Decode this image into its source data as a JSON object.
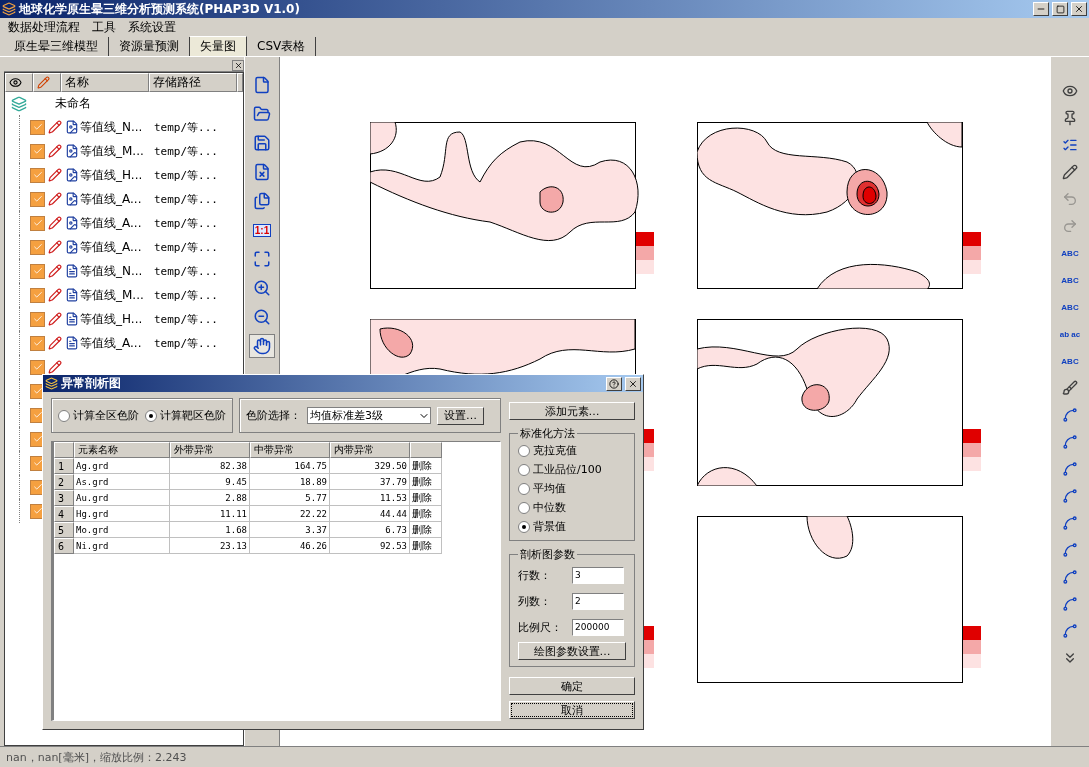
{
  "window": {
    "title": "地球化学原生晕三维分析预测系统(PHAP3D V1.0)"
  },
  "menu": [
    "数据处理流程",
    "工具",
    "系统设置"
  ],
  "tabs": [
    {
      "label": "原生晕三维模型",
      "selected": false
    },
    {
      "label": "资源量预测",
      "selected": false
    },
    {
      "label": "矢量图",
      "selected": true
    },
    {
      "label": "CSV表格",
      "selected": false
    }
  ],
  "layer_panel": {
    "columns": [
      "名称",
      "存储路径"
    ],
    "root": "未命名",
    "layers": [
      {
        "kind": "contour",
        "name": "等值线_N...",
        "path": "temp/等...",
        "checked": true
      },
      {
        "kind": "contour",
        "name": "等值线_M...",
        "path": "temp/等...",
        "checked": true
      },
      {
        "kind": "contour",
        "name": "等值线_H...",
        "path": "temp/等...",
        "checked": true
      },
      {
        "kind": "contour",
        "name": "等值线_A...",
        "path": "temp/等...",
        "checked": true
      },
      {
        "kind": "contour",
        "name": "等值线_A...",
        "path": "temp/等...",
        "checked": true
      },
      {
        "kind": "contour",
        "name": "等值线_A...",
        "path": "temp/等...",
        "checked": true
      },
      {
        "kind": "polygon",
        "name": "等值线_N...",
        "path": "temp/等...",
        "checked": true
      },
      {
        "kind": "polygon",
        "name": "等值线_M...",
        "path": "temp/等...",
        "checked": true
      },
      {
        "kind": "polygon",
        "name": "等值线_H...",
        "path": "temp/等...",
        "checked": true
      },
      {
        "kind": "polygon",
        "name": "等值线_A...",
        "path": "temp/等...",
        "checked": true
      },
      {
        "kind": "polygon",
        "checked": true
      },
      {
        "kind": "polygon",
        "checked": true
      },
      {
        "kind": "polygon",
        "checked": true
      },
      {
        "kind": "polygon",
        "checked": true
      },
      {
        "kind": "polygon",
        "checked": true
      },
      {
        "kind": "polygon",
        "checked": true
      },
      {
        "kind": "polygon",
        "checked": true
      }
    ]
  },
  "view_toolbar": [
    {
      "kind": "new"
    },
    {
      "kind": "open"
    },
    {
      "kind": "save"
    },
    {
      "kind": "delete"
    },
    {
      "kind": "delete-all"
    },
    {
      "kind": "actual-size",
      "label": "1:1"
    },
    {
      "kind": "fit"
    },
    {
      "kind": "zoom-in"
    },
    {
      "kind": "zoom-out"
    },
    {
      "kind": "pan",
      "selected": true
    }
  ],
  "right_toolbar": [
    {
      "kind": "eye"
    },
    {
      "kind": "pin"
    },
    {
      "kind": "list"
    },
    {
      "kind": "pencil"
    },
    {
      "kind": "undo",
      "disabled": true
    },
    {
      "kind": "redo",
      "disabled": true
    },
    {
      "kind": "label-add",
      "label": "ABC"
    },
    {
      "kind": "label-move",
      "label": "ABC"
    },
    {
      "kind": "label-delete",
      "label": "ABC"
    },
    {
      "kind": "label-swap",
      "label": "ab ac"
    },
    {
      "kind": "label-color",
      "label": "ABC"
    },
    {
      "kind": "brush"
    },
    {
      "kind": "curve"
    },
    {
      "kind": "curve"
    },
    {
      "kind": "curve"
    },
    {
      "kind": "curve"
    },
    {
      "kind": "curve"
    },
    {
      "kind": "curve"
    },
    {
      "kind": "curve"
    },
    {
      "kind": "curve"
    },
    {
      "kind": "curve"
    },
    {
      "kind": "more"
    }
  ],
  "dialog": {
    "title": "异常剖析图",
    "scope_options": [
      {
        "label": "计算全区色阶",
        "selected": false
      },
      {
        "label": "计算靶区色阶",
        "selected": true
      }
    ],
    "color_scale_label": "色阶选择：",
    "color_scale_value": "均值标准差3级",
    "settings_button": "设置…",
    "table": {
      "columns": [
        "元素名称",
        "外带异常",
        "中带异常",
        "内带异常"
      ],
      "rows": [
        {
          "index": "1",
          "name": "Ag.grd",
          "outer": "82.38",
          "middle": "164.75",
          "inner": "329.50",
          "action": "删除"
        },
        {
          "index": "2",
          "name": "As.grd",
          "outer": "9.45",
          "middle": "18.89",
          "inner": "37.79",
          "action": "删除"
        },
        {
          "index": "3",
          "name": "Au.grd",
          "outer": "2.88",
          "middle": "5.77",
          "inner": "11.53",
          "action": "删除"
        },
        {
          "index": "4",
          "name": "Hg.grd",
          "outer": "11.11",
          "middle": "22.22",
          "inner": "44.44",
          "action": "删除"
        },
        {
          "index": "5",
          "name": "Mo.grd",
          "outer": "1.68",
          "middle": "3.37",
          "inner": "6.73",
          "action": "删除"
        },
        {
          "index": "6",
          "name": "Ni.grd",
          "outer": "23.13",
          "middle": "46.26",
          "inner": "92.53",
          "action": "删除"
        }
      ]
    },
    "add_button": "添加元素…",
    "normalization": {
      "title": "标准化方法",
      "options": [
        {
          "label": "克拉克值",
          "selected": false
        },
        {
          "label": "工业品位/100",
          "selected": false
        },
        {
          "label": "平均值",
          "selected": false
        },
        {
          "label": "中位数",
          "selected": false
        },
        {
          "label": "背景值",
          "selected": true
        }
      ]
    },
    "params": {
      "title": "剖析图参数",
      "fields": [
        {
          "label": "行数：",
          "value": "3"
        },
        {
          "label": "列数：",
          "value": "2"
        },
        {
          "label": "比例尺：",
          "value": "200000"
        }
      ],
      "button": "绘图参数设置…"
    },
    "ok_button": "确定",
    "cancel_button": "取消"
  },
  "status_bar": "nan，nan[毫米]，缩放比例：2.243"
}
